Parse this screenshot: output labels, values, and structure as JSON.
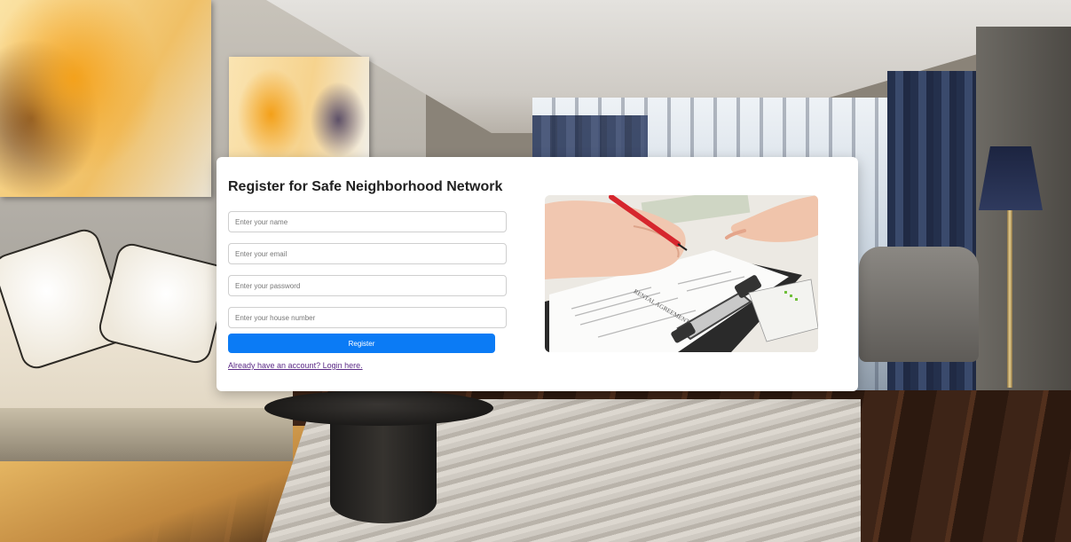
{
  "page": {
    "title": "Register for Safe Neighborhood Network"
  },
  "form": {
    "name_placeholder": "Enter your name",
    "email_placeholder": "Enter your email",
    "password_placeholder": "Enter your password",
    "house_placeholder": "Enter your house number",
    "submit_label": "Register",
    "login_link": "Already have an account? Login here."
  },
  "illustration": {
    "document_heading": "RENTAL AGREEMENT"
  },
  "colors": {
    "primary_button": "#0b7bf5",
    "link_visited": "#5b2a86",
    "card_background": "#ffffff"
  }
}
